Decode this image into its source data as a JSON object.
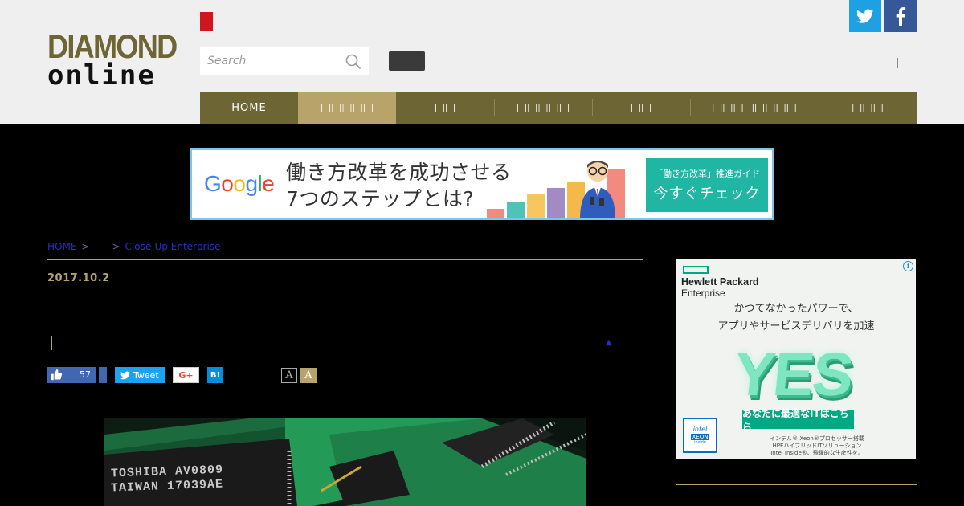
{
  "header": {
    "logo_line1": "DIAMOND",
    "logo_line2": "online",
    "search_placeholder": "Search",
    "separator": "|"
  },
  "nav": {
    "items": [
      {
        "label": "HOME"
      },
      {
        "label": "□□□□□"
      },
      {
        "label": "□□"
      },
      {
        "label": "□□□□□"
      },
      {
        "label": "□□"
      },
      {
        "label": "□□□□□□□□"
      },
      {
        "label": "□□□"
      }
    ]
  },
  "banner": {
    "brand": "Google",
    "headline_line1": "働き方改革を成功させる",
    "headline_line2": "7つのステップとは?",
    "cta_small": "「働き方改革」推進ガイド",
    "cta_big": "今すぐチェック",
    "colors": {
      "accent": "#20b6a3",
      "border": "#7ac6e6"
    }
  },
  "breadcrumb": {
    "home": "HOME",
    "sep1": ">",
    "sep2": ">",
    "current": "Close-Up Enterprise"
  },
  "article": {
    "date": "2017.10.2",
    "triangle": "▲",
    "image_text_1": "TOSHIBA AV0809",
    "image_text_2": "TAIWAN 17039AE"
  },
  "share": {
    "like_count": "57",
    "tweet_label": "Tweet",
    "gplus_label": "G+",
    "hatena_label": "B!",
    "font_small": "A",
    "font_large": "A"
  },
  "side_ad": {
    "brand_line1": "Hewlett Packard",
    "brand_line2": "Enterprise",
    "info": "i",
    "copy_line1": "かつてなかったパワーで、",
    "copy_line2": "アプリやサービスデリバリを加速",
    "big_word": "YES",
    "button": "あなたに最適なITはこちら",
    "intel_top": "intel",
    "intel_mid": "XEON",
    "intel_bottom": "inside",
    "small_line1": "インテル® Xeon®プロセッサー搭載",
    "small_line2": "HPEハイブリッドITソリューション",
    "small_line3": "Intel Inside®、飛躍的な生産性を。"
  },
  "colors": {
    "brand_gold": "#6d6534",
    "nav_active": "#b8a36a",
    "link_blue": "#2b2bd1",
    "twitter": "#1da1e2",
    "facebook": "#365899"
  }
}
